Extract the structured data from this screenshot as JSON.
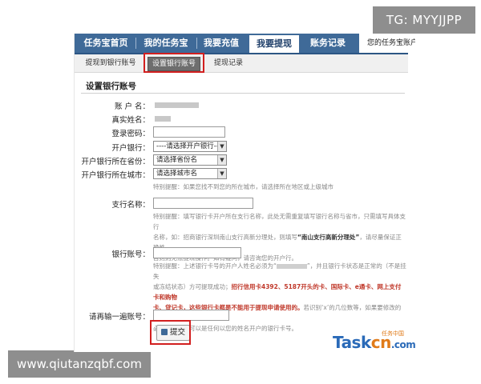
{
  "watermarks": {
    "tg": "TG: MYYJJPP",
    "site": "www.qiutanzqbf.com"
  },
  "topnav": {
    "tabs": [
      "任务宝首页",
      "我的任务宝",
      "我要充值",
      "我要提现",
      "账务记录"
    ],
    "active_tab": "我要提现",
    "right_text": "您的任务宝账户"
  },
  "subnav": {
    "tabs": [
      "提现到银行账号",
      "设置银行账号",
      "提现记录"
    ],
    "active_tab": "设置银行账号"
  },
  "form": {
    "title": "设置银行账号",
    "fields": {
      "account_name_label": "账 户 名：",
      "real_name_label": "真实姓名：",
      "login_password_label": "登录密码：",
      "bank_label": "开户银行：",
      "bank_selected": "----请选择开户银行----",
      "province_label": "开户银行所在省份：",
      "province_selected": "请选择省份名",
      "city_label": "开户银行所在城市：",
      "city_selected": "请选择城市名",
      "branch_label": "支行名称：",
      "card_label": "银行账号：",
      "confirm_label": "请再输一遍账号："
    },
    "tips": {
      "city": "特别提醒：如果您找不到您的所在城市，请选择所在地区或上级城市",
      "branch_1": "特别提醒：填写银行卡开户所在支行名称，此处无需重复填写银行名称与省市，只需填写具体支行",
      "branch_2a": "名称，如：招商银行深圳南山支行高新分理处，则填写",
      "branch_2b": "“南山支行高新分理处”",
      "branch_2c": "，请尽量保证正确性，",
      "branch_3": "否则则无法提现操作。如有疑问，请咨询您的开户行。",
      "card_1a": "特别提醒：上述银行卡号的开户人姓名必须为“",
      "card_1b": "”，并且银行卡状态是正常的（不是挂失",
      "card_2a": "或冻结状态）方可提现成功；",
      "card_2b": "招行信用卡4392、5187开头的卡、国际卡、e通卡、网上支付卡和购物",
      "card_3a": "卡、贷记卡，这些银行卡都是不能用于提现申请使用的。",
      "card_3b": "若识别‘x’的几位数等，如果要修改的话",
      "card_4": "必须要补全，可以是任何以您的姓名开户的银行卡号。"
    },
    "submit_label": "提交"
  },
  "logo": {
    "main": "Task",
    "accent": "cn",
    "suffix": ".com",
    "tag": "任务中国"
  },
  "colors": {
    "nav_bg": "#3f6a98",
    "highlight": "#d21f1f",
    "logo_blue": "#2a6ab8",
    "logo_orange": "#e07b1a"
  }
}
